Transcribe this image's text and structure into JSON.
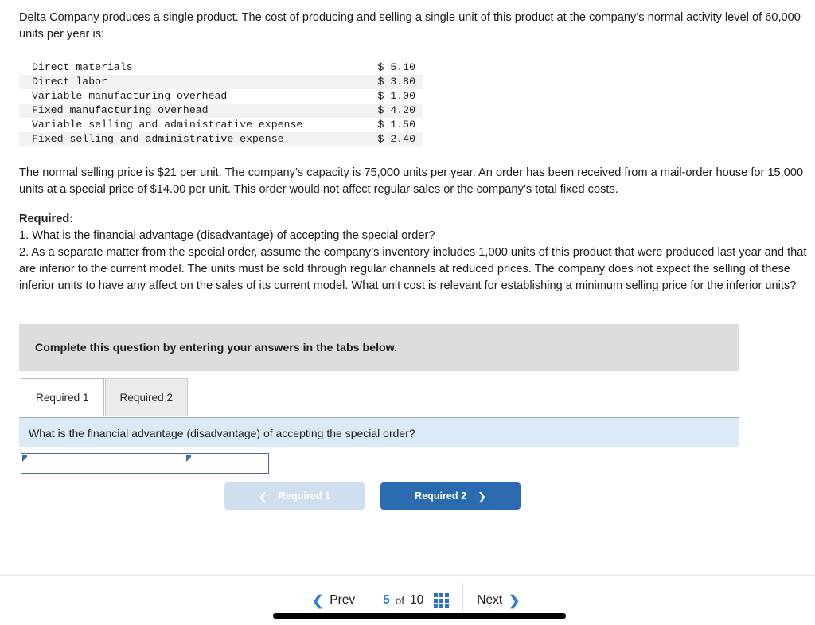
{
  "stem": {
    "text": "Delta Company produces a single product. The cost of producing and selling a single unit of this product at the company’s normal activity level of 60,000 units per year is:"
  },
  "cost_table": {
    "rows": [
      {
        "label": "Direct materials",
        "amount": "$ 5.10"
      },
      {
        "label": "Direct labor",
        "amount": "$ 3.80"
      },
      {
        "label": "Variable manufacturing overhead",
        "amount": "$ 1.00"
      },
      {
        "label": "Fixed manufacturing overhead",
        "amount": "$ 4.20"
      },
      {
        "label": "Variable selling and administrative expense",
        "amount": "$ 1.50"
      },
      {
        "label": "Fixed selling and administrative expense",
        "amount": "$ 2.40"
      }
    ]
  },
  "sale_paragraph": {
    "text": "The normal selling price is $21 per unit. The company’s capacity is 75,000 units per year. An order has been received from a mail-order house for 15,000 units at a special price of $14.00 per unit. This order would not affect regular sales or the company’s total fixed costs."
  },
  "required": {
    "heading": "Required:",
    "item1": "1. What is the financial advantage (disadvantage) of accepting the special order?",
    "item2": "2. As a separate matter from the special order, assume the company’s inventory includes 1,000 units of this product that were produced last year and that are inferior to the current model. The units must be sold through regular channels at reduced prices. The company does not expect the selling of these inferior units to have any affect on the sales of its current model. What unit cost is relevant for establishing a minimum selling price for the inferior units?"
  },
  "instruction": {
    "text": "Complete this question by entering your answers in the tabs below."
  },
  "tabs": [
    {
      "label": "Required 1",
      "active": true
    },
    {
      "label": "Required 2",
      "active": false
    }
  ],
  "question_bar": {
    "text": "What is the financial advantage (disadvantage) of accepting the special order?"
  },
  "answer_row": {
    "cell1_value": "",
    "cell1_placeholder": "",
    "cell2_value": "",
    "cell2_placeholder": ""
  },
  "req_nav": {
    "prev_label": "Required 1",
    "prev_icon": "chevron-left-icon",
    "next_label": "Required 2",
    "next_icon": "chevron-right-icon"
  },
  "pager": {
    "prev_label": "Prev",
    "prev_icon": "chevron-left-icon",
    "current_page": "5",
    "of_label": "of",
    "total_pages": "10",
    "grid_icon": "grid-icon",
    "next_label": "Next",
    "next_icon": "chevron-right-icon"
  },
  "colors": {
    "accent_blue": "#2f7fd0",
    "button_blue": "#2a6bb0",
    "button_blue_disabled": "#cfdff0",
    "banner_gray": "#dddddd",
    "question_bar_blue": "#dbeaf7",
    "input_border": "#4a6c96",
    "row_stripe": "#f2f2f2"
  }
}
